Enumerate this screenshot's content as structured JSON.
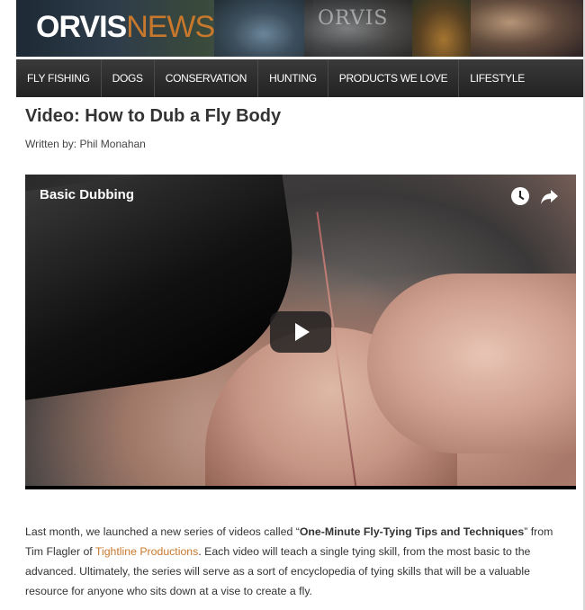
{
  "header": {
    "logo_brand": "ORVIS",
    "logo_section": "NEWS",
    "banner_stamp": "ORVIS"
  },
  "nav": {
    "items": [
      {
        "label": "FLY FISHING"
      },
      {
        "label": "DOGS"
      },
      {
        "label": "CONSERVATION"
      },
      {
        "label": "HUNTING"
      },
      {
        "label": "PRODUCTS WE LOVE"
      },
      {
        "label": "LIFESTYLE"
      }
    ]
  },
  "article": {
    "title": "Video: How to Dub a Fly Body",
    "byline": "Written by: Phil Monahan",
    "video": {
      "title": "Basic Dubbing",
      "icons": [
        "clock-icon",
        "share-icon",
        "play-icon"
      ]
    },
    "paragraph": {
      "part1": "Last month, we launched a new series of videos called “",
      "bold": "One-Minute Fly-Tying Tips and Techniques",
      "part2": "” from Tim Flagler of ",
      "link": "Tightline Productions",
      "part3": ". Each video will teach a single tying skill, from the most basic to the advanced. Ultimately, the series will serve as a sort of encyclopedia of tying skills that will be a valuable resource for anyone who sits down at a vise to create a fly."
    }
  },
  "colors": {
    "accent": "#c8782d",
    "nav_bg": "#2a2a2a",
    "text": "#333333"
  }
}
